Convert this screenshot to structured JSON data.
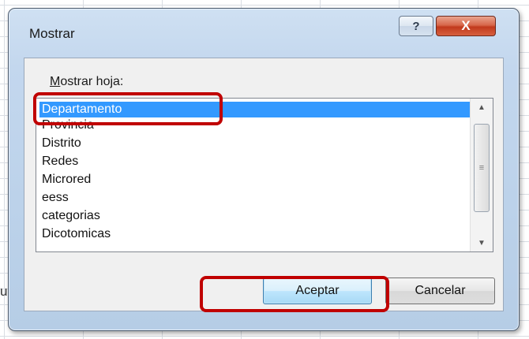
{
  "background": {
    "cell_text": "ue"
  },
  "dialog": {
    "title": "Mostrar",
    "help_label": "?",
    "close_label": "X",
    "list_label_prefix": "M",
    "list_label_rest": "ostrar hoja:",
    "items": [
      "Departamento",
      "Provincia",
      "Distrito",
      "Redes",
      "Microred",
      "eess",
      "categorias",
      "Dicotomicas"
    ],
    "selected_index": 0,
    "ok_label": "Aceptar",
    "cancel_label": "Cancelar"
  },
  "colors": {
    "selection": "#3399ff",
    "highlight": "#c00000",
    "close_button": "#c23a1d"
  },
  "icons": [
    "help-icon",
    "close-icon",
    "scroll-up-icon",
    "scroll-down-icon",
    "scroll-grip-icon"
  ]
}
